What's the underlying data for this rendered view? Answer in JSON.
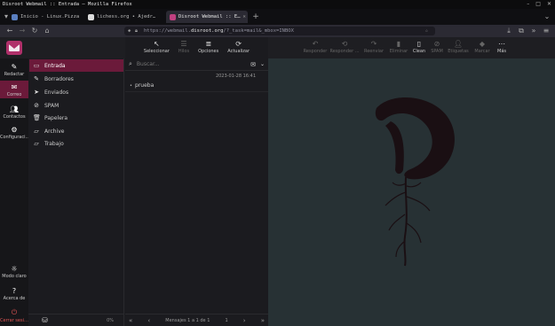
{
  "window": {
    "title": "Disroot Webmail :: Entrada — Mozilla Firefox"
  },
  "tabs": [
    {
      "label": "Inicio - Linux.Pizza",
      "color": "#5a7fc0"
    },
    {
      "label": "lichess.org • Ajedr…",
      "color": "#dddddd"
    },
    {
      "label": "Disroot Webmail :: E…",
      "color": "#c04080"
    }
  ],
  "urlbar": {
    "prefix": "https://webmail.",
    "host": "disroot.org",
    "suffix": "/?_task=mail&_mbox=INBOX"
  },
  "leftnav": {
    "items": [
      {
        "label": "Redactar",
        "icon": "compose-icon"
      },
      {
        "label": "Correo",
        "icon": "mail-icon"
      },
      {
        "label": "Contactos",
        "icon": "contacts-icon"
      },
      {
        "label": "Configuraci…",
        "icon": "settings-icon"
      }
    ],
    "bottom": [
      {
        "label": "Modo claro",
        "icon": "sun-icon"
      },
      {
        "label": "Acerca de",
        "icon": "help-icon"
      },
      {
        "label": "Cerrar sesi…",
        "icon": "power-icon"
      }
    ]
  },
  "folders": [
    {
      "label": "Entrada",
      "icon": "inbox-icon"
    },
    {
      "label": "Borradores",
      "icon": "drafts-icon"
    },
    {
      "label": "Enviados",
      "icon": "sent-icon"
    },
    {
      "label": "SPAM",
      "icon": "spam-icon"
    },
    {
      "label": "Papelera",
      "icon": "trash-icon"
    },
    {
      "label": "Archive",
      "icon": "folder-icon"
    },
    {
      "label": "Trabajo",
      "icon": "folder-icon"
    }
  ],
  "quota": "0%",
  "listtoolbar": [
    {
      "label": "Seleccionar",
      "icon": "cursor-icon"
    },
    {
      "label": "Hilos",
      "icon": "threads-icon"
    },
    {
      "label": "Opciones",
      "icon": "options-icon"
    },
    {
      "label": "Actualizar",
      "icon": "refresh-icon"
    }
  ],
  "search": {
    "placeholder": "Buscar..."
  },
  "messages": [
    {
      "date": "2023-01-28 16:41",
      "subject": "prueba"
    }
  ],
  "listfooter": {
    "count": "Mensajes 1 a 1 de 1",
    "page": "1"
  },
  "msgtoolbar": [
    {
      "label": "Responder",
      "icon": "reply-icon"
    },
    {
      "label": "Responder ...",
      "icon": "reply-all-icon"
    },
    {
      "label": "Reenviar",
      "icon": "forward-icon"
    },
    {
      "label": "Eliminar",
      "icon": "delete-icon"
    },
    {
      "label": "Clean",
      "icon": "clean-icon"
    },
    {
      "label": "SPAM",
      "icon": "spam-icon"
    },
    {
      "label": "Etiquetas",
      "icon": "tag-icon"
    },
    {
      "label": "Marcar",
      "icon": "mark-icon"
    },
    {
      "label": "Más",
      "icon": "more-icon"
    }
  ],
  "colors": {
    "accent": "#6b1a3a",
    "preview_bg": "#273134",
    "logo": "#1a0f13"
  }
}
